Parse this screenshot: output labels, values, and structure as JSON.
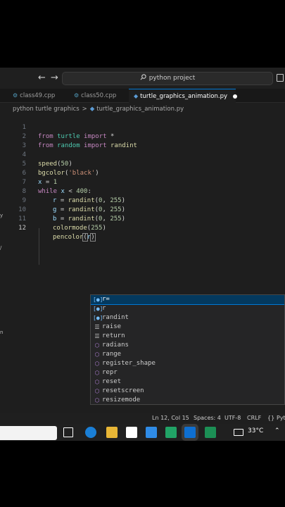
{
  "titlebar": {
    "back_icon": "arrow-left-icon",
    "forward_icon": "arrow-right-icon",
    "search_icon": "search-icon",
    "command_center": "python project"
  },
  "tabs": [
    {
      "label": "class49.cpp",
      "icon": "cpp-file-icon",
      "active": false
    },
    {
      "label": "class50.cpp",
      "icon": "cpp-file-icon",
      "active": false
    },
    {
      "label": "turtle_graphics_animation.py",
      "icon": "python-file-icon",
      "active": true,
      "unsaved": true
    }
  ],
  "breadcrumb": {
    "folder": "python turtle graphics",
    "separator": ">",
    "file": "turtle_graphics_animation.py"
  },
  "code_lines": [
    {
      "n": "1"
    },
    {
      "n": "2"
    },
    {
      "n": "3"
    },
    {
      "n": "4"
    },
    {
      "n": "5"
    },
    {
      "n": "6"
    },
    {
      "n": "7"
    },
    {
      "n": "8"
    },
    {
      "n": "9"
    },
    {
      "n": "10"
    },
    {
      "n": "11"
    },
    {
      "n": "12"
    }
  ],
  "code": {
    "l1": [
      "from",
      " ",
      "turtle",
      " ",
      "import",
      " *"
    ],
    "l2": [
      "from",
      " ",
      "random",
      " ",
      "import",
      " ",
      "randint"
    ],
    "l4": [
      "speed",
      "(",
      "50",
      ")"
    ],
    "l5": [
      "bgcolor",
      "(",
      "'black'",
      ")"
    ],
    "l6": [
      "x",
      " = ",
      "1"
    ],
    "l7": [
      "while",
      " ",
      "x",
      " < ",
      "400",
      ":"
    ],
    "l8": [
      "r",
      " = ",
      "randint",
      "(",
      "0",
      ", ",
      "255",
      ")"
    ],
    "l9": [
      "g",
      " = ",
      "randint",
      "(",
      "0",
      ", ",
      "255",
      ")"
    ],
    "l10": [
      "b",
      " = ",
      "randint",
      "(",
      "0",
      ", ",
      "255",
      ")"
    ],
    "l11": [
      "colormode",
      "(",
      "255",
      ")"
    ],
    "l12": [
      "pencolor",
      "(",
      "r",
      ")"
    ]
  },
  "suggestions": [
    {
      "label": "r=",
      "icon": "variable-icon",
      "selected": true
    },
    {
      "label": "r",
      "icon": "variable-icon"
    },
    {
      "label": "randint",
      "icon": "variable-icon"
    },
    {
      "label": "raise",
      "icon": "keyword-icon"
    },
    {
      "label": "return",
      "icon": "keyword-icon"
    },
    {
      "label": "radians",
      "icon": "function-icon"
    },
    {
      "label": "range",
      "icon": "function-icon"
    },
    {
      "label": "register_shape",
      "icon": "function-icon"
    },
    {
      "label": "repr",
      "icon": "function-icon"
    },
    {
      "label": "reset",
      "icon": "function-icon"
    },
    {
      "label": "resetscreen",
      "icon": "function-icon"
    },
    {
      "label": "resizemode",
      "icon": "function-icon"
    }
  ],
  "side_fragments": [
    "y",
    "/",
    "n"
  ],
  "statusbar": {
    "position": "Ln 12, Col 15",
    "spaces": "Spaces: 4",
    "encoding": "UTF-8",
    "eol": "CRLF",
    "lang_icon": "braces-icon",
    "language": "Pyt"
  },
  "taskbar": {
    "temperature": "33°C",
    "weather_icon": "weather-icon",
    "chevron_icon": "chevron-up-icon"
  },
  "colors": {
    "accent": "#0078d4",
    "editor_bg": "#1e1e1e"
  }
}
